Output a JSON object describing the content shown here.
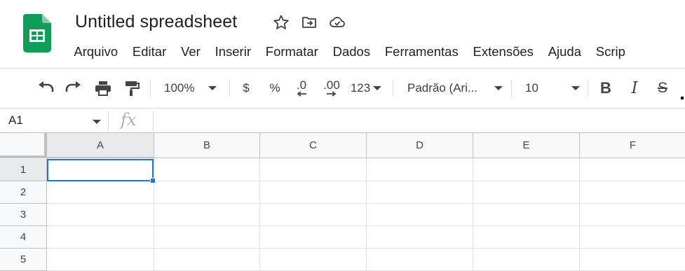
{
  "doc_title": "Untitled spreadsheet",
  "icons": {
    "logo": "google-sheets-icon",
    "star": "star-icon",
    "move": "folder-move-icon",
    "cloud": "cloud-status-icon"
  },
  "menu": [
    "Arquivo",
    "Editar",
    "Ver",
    "Inserir",
    "Formatar",
    "Dados",
    "Ferramentas",
    "Extensões",
    "Ajuda",
    "Scrip"
  ],
  "toolbar": {
    "zoom": "100%",
    "currency": "$",
    "percent": "%",
    "decrease_decimal": ".0",
    "increase_decimal": ".00",
    "more_formats": "123",
    "font": "Padrão (Ari...",
    "font_size": "10",
    "bold": "B",
    "italic": "I",
    "strike": "S"
  },
  "formula_bar": {
    "name_box": "A1",
    "fx": "fx",
    "value": ""
  },
  "grid": {
    "columns": [
      "A",
      "B",
      "C",
      "D",
      "E",
      "F"
    ],
    "rows": [
      "1",
      "2",
      "3",
      "4",
      "5"
    ],
    "selected_cell": "A1"
  },
  "colors": {
    "accent": "#1a73e8",
    "sheets_green": "#0f9d58"
  }
}
